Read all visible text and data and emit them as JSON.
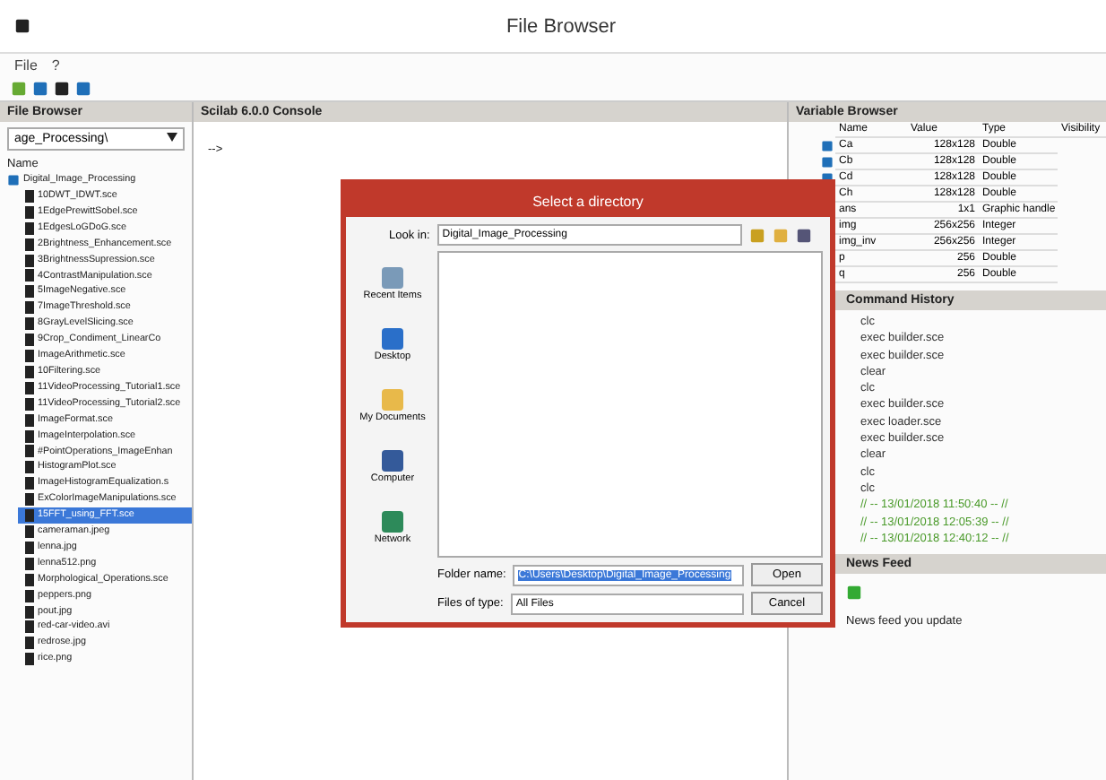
{
  "window": {
    "title": "File Browser"
  },
  "menu": [
    "File",
    "?"
  ],
  "file_browser": {
    "title": "File Browser",
    "path": "age_Processing\\",
    "column": "Name",
    "root": "Digital_Image_Processing",
    "files": [
      {
        "name": "10DWT_IDWT.sce",
        "selected": false
      },
      {
        "name": "1EdgePrewittSobel.sce",
        "selected": false
      },
      {
        "name": "1EdgesLoGDoG.sce",
        "selected": false
      },
      {
        "name": "2Brightness_Enhancement.sce",
        "selected": false
      },
      {
        "name": "3BrightnessSupression.sce",
        "selected": false
      },
      {
        "name": "4ContrastManipulation.sce",
        "selected": false
      },
      {
        "name": "5ImageNegative.sce",
        "selected": false
      },
      {
        "name": "7ImageThreshold.sce",
        "selected": false
      },
      {
        "name": "8GrayLevelSlicing.sce",
        "selected": false
      },
      {
        "name": "9Crop_Condiment_LinearCo",
        "selected": false
      },
      {
        "name": "ImageArithmetic.sce",
        "selected": false
      },
      {
        "name": "10Filtering.sce",
        "selected": false
      },
      {
        "name": "11VideoProcessing_Tutorial1.sce",
        "selected": false
      },
      {
        "name": "11VideoProcessing_Tutorial2.sce",
        "selected": false
      },
      {
        "name": "ImageFormat.sce",
        "selected": false
      },
      {
        "name": "ImageInterpolation.sce",
        "selected": false
      },
      {
        "name": "#PointOperations_ImageEnhan",
        "selected": false
      },
      {
        "name": "HistogramPlot.sce",
        "selected": false
      },
      {
        "name": "ImageHistogramEqualization.s",
        "selected": false
      },
      {
        "name": "ExColorImageManipulations.sce",
        "selected": false
      },
      {
        "name": "15FFT_using_FFT.sce",
        "selected": true
      },
      {
        "name": "cameraman.jpeg",
        "selected": false
      },
      {
        "name": "lenna.jpg",
        "selected": false
      },
      {
        "name": "lenna512.png",
        "selected": false
      },
      {
        "name": "Morphological_Operations.sce",
        "selected": false
      },
      {
        "name": "peppers.png",
        "selected": false
      },
      {
        "name": "pout.jpg",
        "selected": false
      },
      {
        "name": "red-car-video.avi",
        "selected": false
      },
      {
        "name": "redrose.jpg",
        "selected": false
      },
      {
        "name": "rice.png",
        "selected": false
      }
    ]
  },
  "console": {
    "title": "Scilab 6.0.0 Console",
    "prompt": "-->"
  },
  "variable_browser": {
    "title": "Variable Browser",
    "columns": [
      "Name",
      "Value",
      "Type",
      "Visibility"
    ],
    "rows": [
      [
        "Ca",
        "128x128",
        "Double"
      ],
      [
        "Cb",
        "128x128",
        "Double"
      ],
      [
        "Cd",
        "128x128",
        "Double"
      ],
      [
        "Ch",
        "128x128",
        "Double"
      ],
      [
        "ans",
        "1x1",
        "Graphic handle"
      ],
      [
        "img",
        "256x256",
        "Integer"
      ],
      [
        "img_inv",
        "256x256",
        "Integer"
      ],
      [
        "p",
        "256",
        "Double"
      ],
      [
        "q",
        "256",
        "Double"
      ]
    ]
  },
  "command_history": {
    "title": "Command History",
    "lines": [
      {
        "text": "clc",
        "kind": "command"
      },
      {
        "text": "exec builder.sce",
        "kind": "command"
      },
      {
        "text": "exec builder.sce",
        "kind": "command"
      },
      {
        "text": "clear",
        "kind": "command"
      },
      {
        "text": "clc",
        "kind": "command"
      },
      {
        "text": "exec builder.sce",
        "kind": "command"
      },
      {
        "text": "exec loader.sce",
        "kind": "command"
      },
      {
        "text": "exec builder.sce",
        "kind": "command"
      },
      {
        "text": "clear",
        "kind": "command"
      },
      {
        "text": "clc",
        "kind": "command"
      },
      {
        "text": "clc",
        "kind": "command"
      },
      {
        "text": "// -- 13/01/2018 11:50:40 -- //",
        "kind": "session"
      },
      {
        "text": "// -- 13/01/2018 12:05:39 -- //",
        "kind": "session"
      },
      {
        "text": "// -- 13/01/2018 12:40:12 -- //",
        "kind": "session"
      }
    ]
  },
  "news_feed": {
    "title": "News Feed",
    "message": "News feed you update"
  },
  "dialog": {
    "title": "Select a directory",
    "look_in_label": "Look in:",
    "look_in": "Digital_Image_Processing",
    "places": [
      "Recent Items",
      "Desktop",
      "My Documents",
      "Computer",
      "Network"
    ],
    "folder_label": "Folder name:",
    "folder_value": "C:\\Users\\Desktop\\Digital_Image_Processing",
    "type_label": "Files of type:",
    "type_value": "All Files",
    "buttons": [
      "Open",
      "Cancel"
    ]
  }
}
